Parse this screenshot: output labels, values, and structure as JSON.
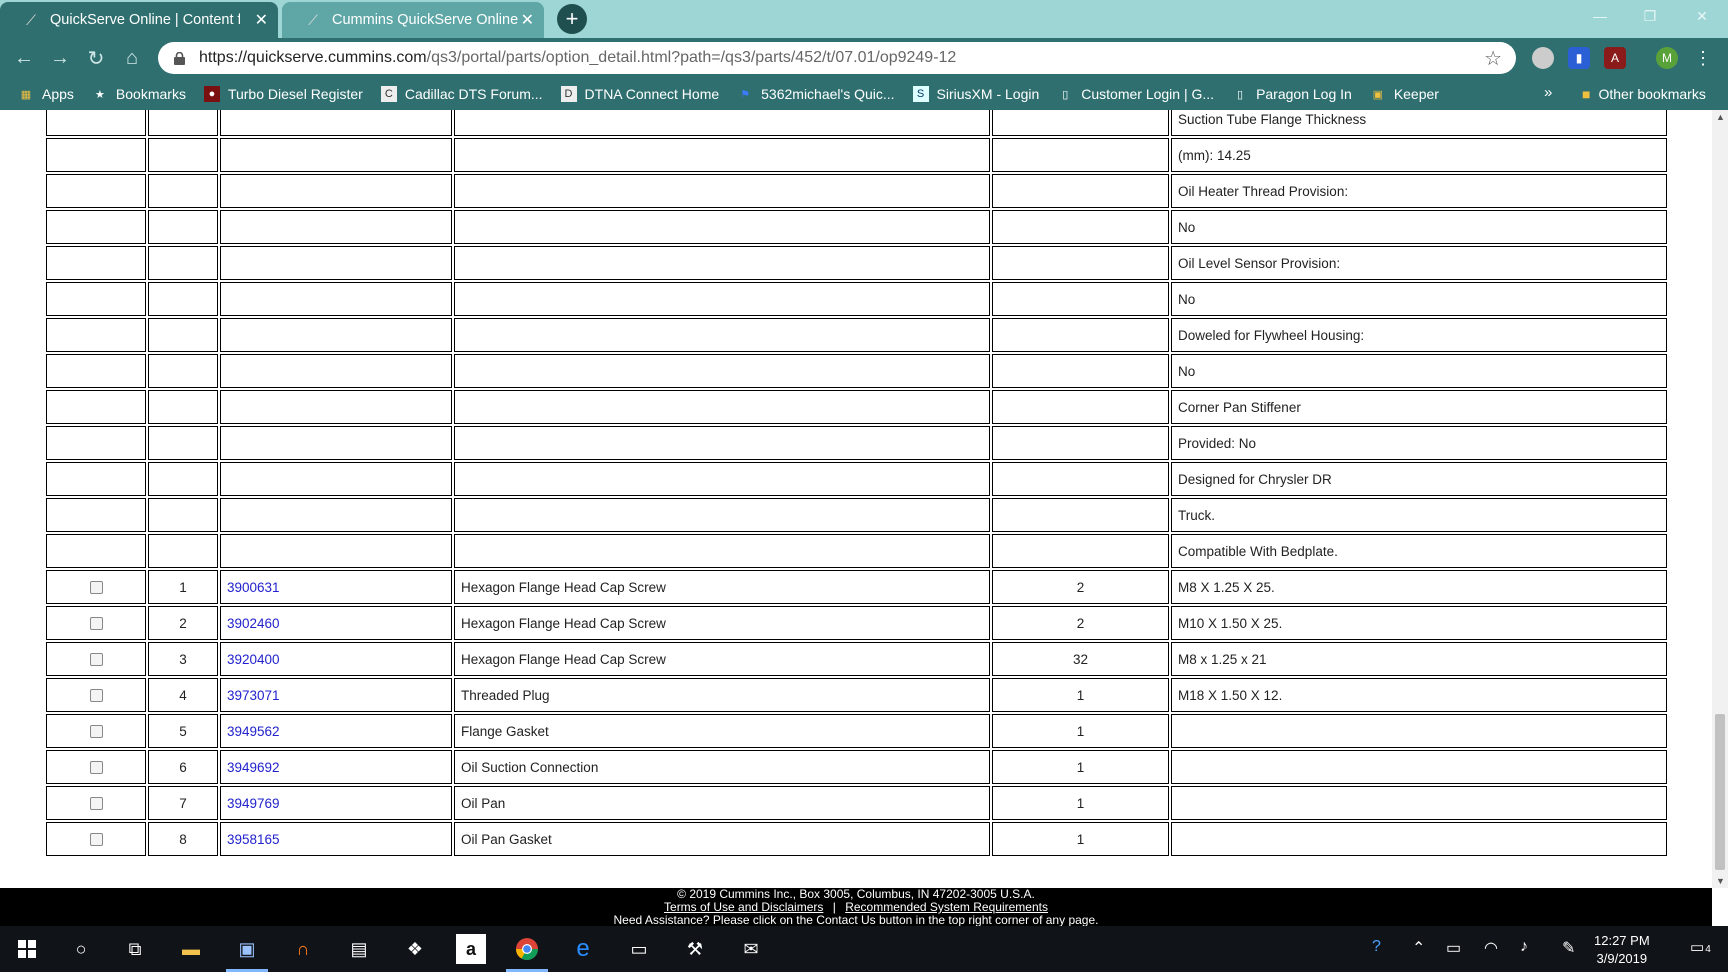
{
  "browser": {
    "tabs": [
      {
        "title": "QuickServe Online | Content for I"
      },
      {
        "title": "Cummins QuickServe Online"
      }
    ],
    "url_host": "https://quickserve.cummins.com",
    "url_path": "/qs3/portal/parts/option_detail.html?path=/qs3/parts/452/t/07.01/op9249-12",
    "profile_initial": "M"
  },
  "bookmarks": {
    "items": [
      {
        "label": "Apps",
        "icon": "apps-grid-icon"
      },
      {
        "label": "Bookmarks",
        "icon": "star-icon"
      },
      {
        "label": "Turbo Diesel Register",
        "icon": "tdr-icon"
      },
      {
        "label": "Cadillac DTS Forum...",
        "icon": "cadillac-icon"
      },
      {
        "label": "DTNA Connect Home",
        "icon": "dtna-icon"
      },
      {
        "label": "5362michael's Quic...",
        "icon": "flag-icon"
      },
      {
        "label": "SiriusXM - Login",
        "icon": "siriusxm-icon"
      },
      {
        "label": "Customer Login | G...",
        "icon": "page-icon"
      },
      {
        "label": "Paragon Log In",
        "icon": "page-icon"
      },
      {
        "label": "Keeper",
        "icon": "keeper-icon"
      }
    ],
    "more": "»",
    "other": "Other bookmarks"
  },
  "table": {
    "spec_rows": [
      "Suction Tube Flange Thickness",
      "(mm): 14.25",
      "Oil Heater Thread Provision:",
      "No",
      "Oil Level Sensor Provision:",
      "No",
      "Doweled for Flywheel Housing:",
      "No",
      "Corner Pan Stiffener",
      "Provided: No",
      "Designed for Chrysler DR",
      "Truck.",
      "Compatible With Bedplate."
    ],
    "parts": [
      {
        "ref": "1",
        "part": "3900631",
        "desc": "Hexagon Flange Head Cap Screw",
        "qty": "2",
        "note": "M8 X 1.25 X 25."
      },
      {
        "ref": "2",
        "part": "3902460",
        "desc": "Hexagon Flange Head Cap Screw",
        "qty": "2",
        "note": "M10 X 1.50 X 25."
      },
      {
        "ref": "3",
        "part": "3920400",
        "desc": "Hexagon Flange Head Cap Screw",
        "qty": "32",
        "note": "M8 x 1.25 x 21"
      },
      {
        "ref": "4",
        "part": "3973071",
        "desc": "Threaded Plug",
        "qty": "1",
        "note": "M18 X 1.50 X 12."
      },
      {
        "ref": "5",
        "part": "3949562",
        "desc": "Flange Gasket",
        "qty": "1",
        "note": ""
      },
      {
        "ref": "6",
        "part": "3949692",
        "desc": "Oil Suction Connection",
        "qty": "1",
        "note": ""
      },
      {
        "ref": "7",
        "part": "3949769",
        "desc": "Oil Pan",
        "qty": "1",
        "note": ""
      },
      {
        "ref": "8",
        "part": "3958165",
        "desc": "Oil Pan Gasket",
        "qty": "1",
        "note": ""
      }
    ]
  },
  "footer": {
    "copyright": "© 2019 Cummins Inc., Box 3005, Columbus, IN 47202-3005 U.S.A.",
    "terms": "Terms of Use and Disclaimers",
    "separator": "|",
    "requirements": "Recommended System Requirements",
    "assist": "Need Assistance? Please click on the Contact Us button in the top right corner of any page."
  },
  "taskbar": {
    "time": "12:27 PM",
    "date": "3/9/2019",
    "notifications": "4"
  },
  "colors": {
    "chrome_frame": "#2f6f6f",
    "tab_strip": "#9ed6d6",
    "link": "#2222cc"
  }
}
